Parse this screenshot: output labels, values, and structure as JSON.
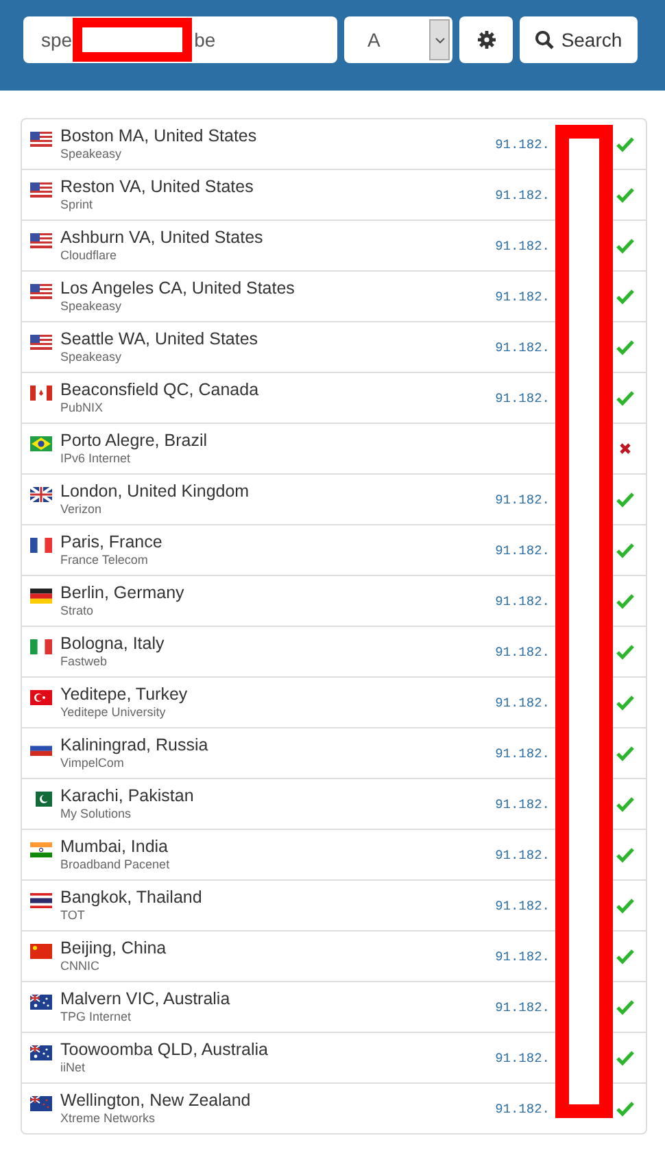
{
  "search": {
    "value_start": "spe",
    "value_end": "be",
    "record_type": "A",
    "button": "Search"
  },
  "servers": [
    {
      "location": "Boston MA, United States",
      "provider": "Speakeasy",
      "kind": "us",
      "ip": "91.182.",
      "ok": true
    },
    {
      "location": "Reston VA, United States",
      "provider": "Sprint",
      "kind": "us",
      "ip": "91.182.",
      "ok": true
    },
    {
      "location": "Ashburn VA, United States",
      "provider": "Cloudflare",
      "kind": "us",
      "ip": "91.182.",
      "ok": true
    },
    {
      "location": "Los Angeles CA, United States",
      "provider": "Speakeasy",
      "kind": "us",
      "ip": "91.182.",
      "ok": true
    },
    {
      "location": "Seattle WA, United States",
      "provider": "Speakeasy",
      "kind": "us",
      "ip": "91.182.",
      "ok": true
    },
    {
      "location": "Beaconsfield QC, Canada",
      "provider": "PubNIX",
      "kind": "ca",
      "ip": "91.182.",
      "ok": true
    },
    {
      "location": "Porto Alegre, Brazil",
      "provider": "IPv6 Internet",
      "kind": "br",
      "ok": false
    },
    {
      "location": "London, United Kingdom",
      "provider": "Verizon",
      "kind": "gb",
      "ip": "91.182.",
      "ok": true
    },
    {
      "location": "Paris, France",
      "provider": "France Telecom",
      "kind": "fr",
      "ip": "91.182.",
      "ok": true
    },
    {
      "location": "Berlin, Germany",
      "provider": "Strato",
      "kind": "de",
      "ip": "91.182.",
      "ok": true
    },
    {
      "location": "Bologna, Italy",
      "provider": "Fastweb",
      "kind": "it",
      "ip": "91.182.",
      "ok": true
    },
    {
      "location": "Yeditepe, Turkey",
      "provider": "Yeditepe University",
      "kind": "tr",
      "ip": "91.182.",
      "ok": true
    },
    {
      "location": "Kaliningrad, Russia",
      "provider": "VimpelCom",
      "kind": "ru",
      "ip": "91.182.",
      "ok": true
    },
    {
      "location": "Karachi, Pakistan",
      "provider": "My Solutions",
      "kind": "pk",
      "ip": "91.182.",
      "ok": true
    },
    {
      "location": "Mumbai, India",
      "provider": "Broadband Pacenet",
      "kind": "in",
      "ip": "91.182.",
      "ok": true
    },
    {
      "location": "Bangkok, Thailand",
      "provider": "TOT",
      "kind": "th",
      "ip": "91.182.",
      "ok": true
    },
    {
      "location": "Beijing, China",
      "provider": "CNNIC",
      "kind": "cn",
      "ip": "91.182.",
      "ok": true
    },
    {
      "location": "Malvern VIC, Australia",
      "provider": "TPG Internet",
      "kind": "au",
      "ip": "91.182.",
      "ok": true
    },
    {
      "location": "Toowoomba QLD, Australia",
      "provider": "iiNet",
      "kind": "au",
      "ip": "91.182.",
      "ok": true
    },
    {
      "location": "Wellington, New Zealand",
      "provider": "Xtreme Networks",
      "kind": "nz",
      "ip": "91.182.",
      "ok": true
    }
  ]
}
